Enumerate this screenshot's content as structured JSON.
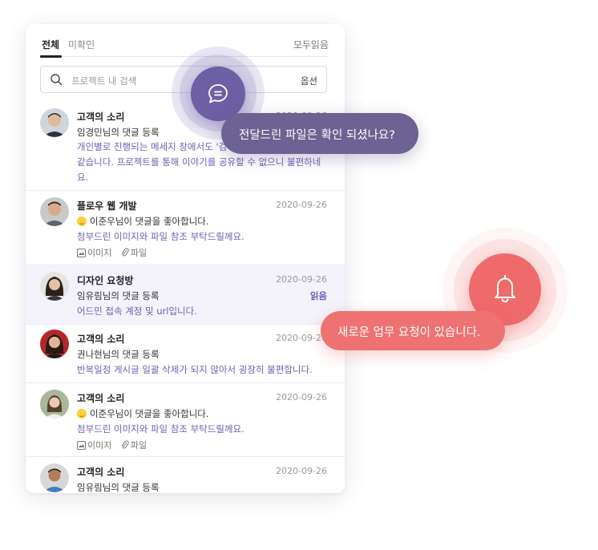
{
  "tabs": {
    "all": "전체",
    "unread": "미확인",
    "mark_all": "모두읽음"
  },
  "search": {
    "placeholder": "프로젝트 내 검색",
    "options": "옵션"
  },
  "items": [
    {
      "title": "고객의 소리",
      "date": "2020-09-26",
      "line1": "임경민님의 댓글 등록",
      "message": "개인별로 진행되는 메세지 창에서도 '검색' 기능이 있으면 좋을 것 같습니다. 프로젝트를 통해 이야기를 공유할 수 없으니 불편하네요."
    },
    {
      "title": "플로우 웹 개발",
      "date": "2020-09-26",
      "line1": "이준우님이 댓글을 좋아합니다.",
      "message": "첨부드린 이미지와 파일 참조 부탁드릴께요.",
      "attach_image": "이미지",
      "attach_file": "파일"
    },
    {
      "title": "디자인 요청방",
      "date": "2020-09-26",
      "line1": "임유림님의 댓글 등록",
      "badge": "읽음",
      "message": "어드민 접속 계정 및 url입니다."
    },
    {
      "title": "고객의 소리",
      "date": "2020-09-26",
      "line1": "권나현님의 댓글 등록",
      "message": "반복일정 게시글 일괄 삭제가 되지 않아서 굉장히 불편합니다."
    },
    {
      "title": "고객의 소리",
      "date": "2020-09-26",
      "line1": "이준우님이 댓글을 좋아합니다.",
      "message": "첨부드린 이미지와 파일 참조 부탁드릴께요.",
      "attach_image": "이미지",
      "attach_file": "파일"
    },
    {
      "title": "고객의 소리",
      "date": "2020-09-26",
      "line1": "임유림님의 댓글 등록"
    }
  ],
  "toasts": {
    "chat": "전달드린 파일은 확인 되셨나요?",
    "bell": "새로운 업무 요청이 있습니다."
  },
  "colors": {
    "accent_purple": "#6d5fa3",
    "accent_red": "#ef6a6a"
  }
}
